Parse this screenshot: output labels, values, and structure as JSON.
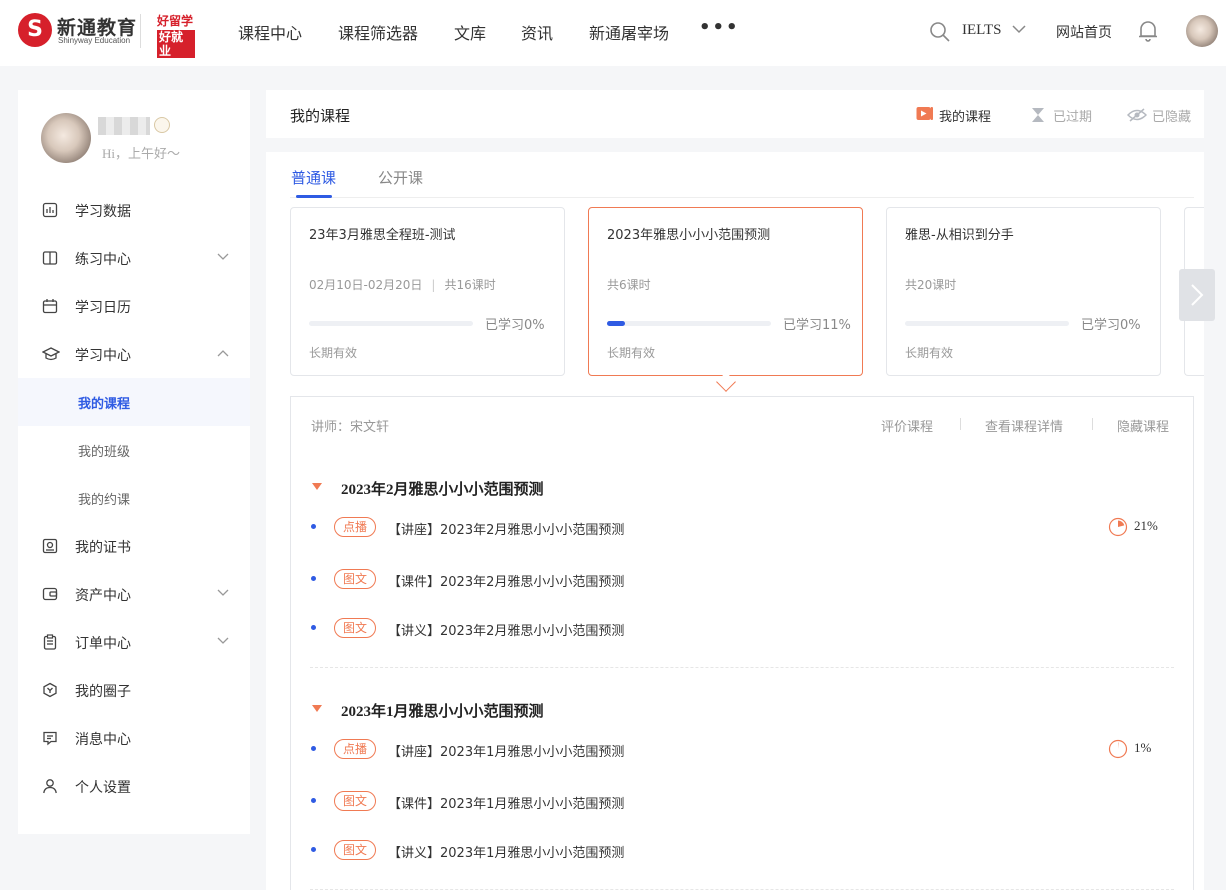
{
  "brand": {
    "cn": "新通教育",
    "en": "Shinyway Education",
    "badge_top": "好留学",
    "badge_bottom": "好就业",
    "mark": "S",
    "color": "#d6202b"
  },
  "nav": [
    "课程中心",
    "课程筛选器",
    "文库",
    "资讯",
    "新通屠宰场"
  ],
  "header": {
    "exam": "IELTS",
    "home": "网站首页"
  },
  "user": {
    "greeting": "Hi，上午好～"
  },
  "sidebar": {
    "items": [
      {
        "label": "学习数据",
        "icon": "bar-chart-icon"
      },
      {
        "label": "练习中心",
        "icon": "book-icon"
      },
      {
        "label": "学习日历",
        "icon": "calendar-icon"
      },
      {
        "label": "学习中心",
        "icon": "graduation-cap-icon"
      },
      {
        "label": "我的证书",
        "icon": "certificate-icon"
      },
      {
        "label": "资产中心",
        "icon": "wallet-icon"
      },
      {
        "label": "订单中心",
        "icon": "clipboard-icon"
      },
      {
        "label": "我的圈子",
        "icon": "circle-icon"
      },
      {
        "label": "消息中心",
        "icon": "message-icon"
      },
      {
        "label": "个人设置",
        "icon": "user-icon"
      }
    ],
    "sub": [
      "我的课程",
      "我的班级",
      "我的约课"
    ]
  },
  "page": {
    "title": "我的课程",
    "filters": [
      "我的课程",
      "已过期",
      "已隐藏"
    ],
    "tabs": [
      "普通课",
      "公开课"
    ]
  },
  "accent": "#2f5be3",
  "highlight": "#f07a53",
  "courses": [
    {
      "title": "23年3月雅思全程班-测试",
      "date": "02月10日-02月20日",
      "hours": "共16课时",
      "progress_label": "已学习0%",
      "progress": 0,
      "validity": "长期有效"
    },
    {
      "title": "2023年雅思小小小范围预测",
      "hours": "共6课时",
      "progress_label": "已学习11%",
      "progress": 11,
      "validity": "长期有效"
    },
    {
      "title": "雅思-从相识到分手",
      "hours": "共20课时",
      "progress_label": "已学习0%",
      "progress": 0,
      "validity": "长期有效"
    }
  ],
  "detail": {
    "teacher": "讲师：宋文轩",
    "actions": [
      "评价课程",
      "查看课程详情",
      "隐藏课程"
    ],
    "sections": [
      {
        "title": "2023年2月雅思小小小范围预测",
        "items": [
          {
            "tag": "点播",
            "text": "【讲座】2023年2月雅思小小小范围预测",
            "percent": "21%",
            "progress": 21
          },
          {
            "tag": "图文",
            "text": "【课件】2023年2月雅思小小小范围预测"
          },
          {
            "tag": "图文",
            "text": "【讲义】2023年2月雅思小小小范围预测"
          }
        ]
      },
      {
        "title": "2023年1月雅思小小小范围预测",
        "items": [
          {
            "tag": "点播",
            "text": "【讲座】2023年1月雅思小小小范围预测",
            "percent": "1%",
            "progress": 1
          },
          {
            "tag": "图文",
            "text": "【课件】2023年1月雅思小小小范围预测"
          },
          {
            "tag": "图文",
            "text": "【讲义】2023年1月雅思小小小范围预测"
          }
        ]
      }
    ]
  }
}
